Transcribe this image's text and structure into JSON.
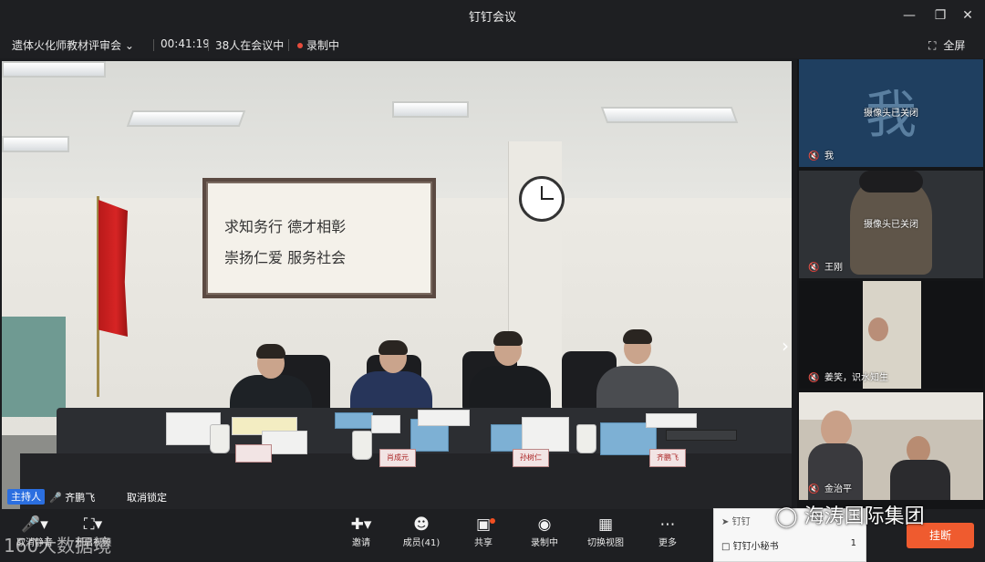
{
  "window": {
    "title": "钉钉会议"
  },
  "info": {
    "meeting_name": "遗体火化师教材评审会",
    "duration": "00:41:19",
    "participants": "38人在会议中",
    "recording": "录制中",
    "fullscreen": "全屏"
  },
  "main_video": {
    "host_badge": "主持人",
    "speaker": "齐鹏飞",
    "unlock": "取消锁定",
    "plaque_line1": "求知务行  德才相彰",
    "plaque_line2": "崇扬仁爱  服务社会",
    "namecards": [
      "",
      "肖成元",
      "孙树仁",
      "齐鹏飞"
    ]
  },
  "side_tiles": [
    {
      "name": "我",
      "status": "摄像头已关闭",
      "avatar_char": "我"
    },
    {
      "name": "王刚",
      "status": "摄像头已关闭"
    },
    {
      "name": "姜笑，识水知生",
      "status": ""
    },
    {
      "name": "金治平",
      "status": ""
    }
  ],
  "toolbar": {
    "mute": "取消静音",
    "camera": "开启视频",
    "invite": "邀请",
    "members": "成员(41)",
    "share": "共享",
    "recording": "录制中",
    "switch_view": "切换视图",
    "more": "更多",
    "end": "挂断"
  },
  "popup": {
    "brand": "钉钉",
    "item": "钉钉小秘书",
    "count": "1"
  },
  "watermarks": {
    "right": "海涛国际集团",
    "left": "160大数据境"
  }
}
